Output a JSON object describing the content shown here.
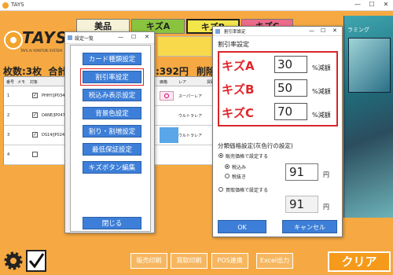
{
  "app": {
    "title": "TAYS"
  },
  "window_controls": {
    "minimize": "—",
    "maximize": "☐",
    "close": "✕"
  },
  "logo": {
    "text": "TAYS",
    "sub": "TAYS AI YOMITORI SYSTEM"
  },
  "tabs": [
    {
      "label": "美品",
      "color": "#f6f2d8"
    },
    {
      "label": "キズA",
      "color": "#8ac43f"
    },
    {
      "label": "キズB",
      "color": "#f2e64a"
    },
    {
      "label": "キズC",
      "color": "#ec6b8a"
    }
  ],
  "card_image": {
    "label": "ラミング"
  },
  "summary": {
    "count": "枚数:3枚",
    "total_prefix": "合計",
    "total_amount": ":392円",
    "delete": "削除"
  },
  "grid": {
    "headers": [
      "番号",
      "メモ",
      "対象",
      "",
      "価格",
      "レア",
      "買取"
    ],
    "rows": [
      {
        "num": "1",
        "checked": "✓",
        "code": "PHHY/JP034",
        "rarity": "スーパーレア"
      },
      {
        "num": "2",
        "checked": "✓",
        "code": "DANE/JP047",
        "rarity": "ウルトラレア"
      },
      {
        "num": "3",
        "checked": "✓",
        "code": "DS14/JP024",
        "rarity": "ウルトラレア"
      },
      {
        "num": "4",
        "checked": "",
        "code": "",
        "rarity": ""
      }
    ]
  },
  "settings_list": {
    "title": "設定一覧",
    "buttons": [
      "カード種類設定",
      "割引率設定",
      "税込み表示設定",
      "背景色設定",
      "割り・割増設定",
      "最低保証設定",
      "キズボタン編集"
    ],
    "close": "閉じる"
  },
  "discount_dialog": {
    "title": "割引率設定",
    "heading": "割引率設定",
    "rates": [
      {
        "label": "キズA",
        "value": "30",
        "unit": "%減額"
      },
      {
        "label": "キズB",
        "value": "50",
        "unit": "%減額"
      },
      {
        "label": "キズC",
        "value": "70",
        "unit": "%減額"
      }
    ],
    "category_heading": "分類価格設定(灰色行の設定)",
    "sell_option": "販売価格で設定する",
    "tax_in": "税込み",
    "tax_out": "税抜き",
    "sell_value": "91",
    "buy_option": "買取価格で設定する",
    "buy_value": "91",
    "yen": "円",
    "ok": "OK",
    "cancel": "キャンセル"
  },
  "footer": {
    "sales_print": "販売印刷",
    "buy_print": "買取印刷",
    "pos": "POS連携",
    "excel": "Excel出力",
    "clear": "クリア"
  },
  "colors": {
    "accent": "#3d7fd8",
    "highlight": "#e0262c",
    "background": "#f6a942"
  }
}
